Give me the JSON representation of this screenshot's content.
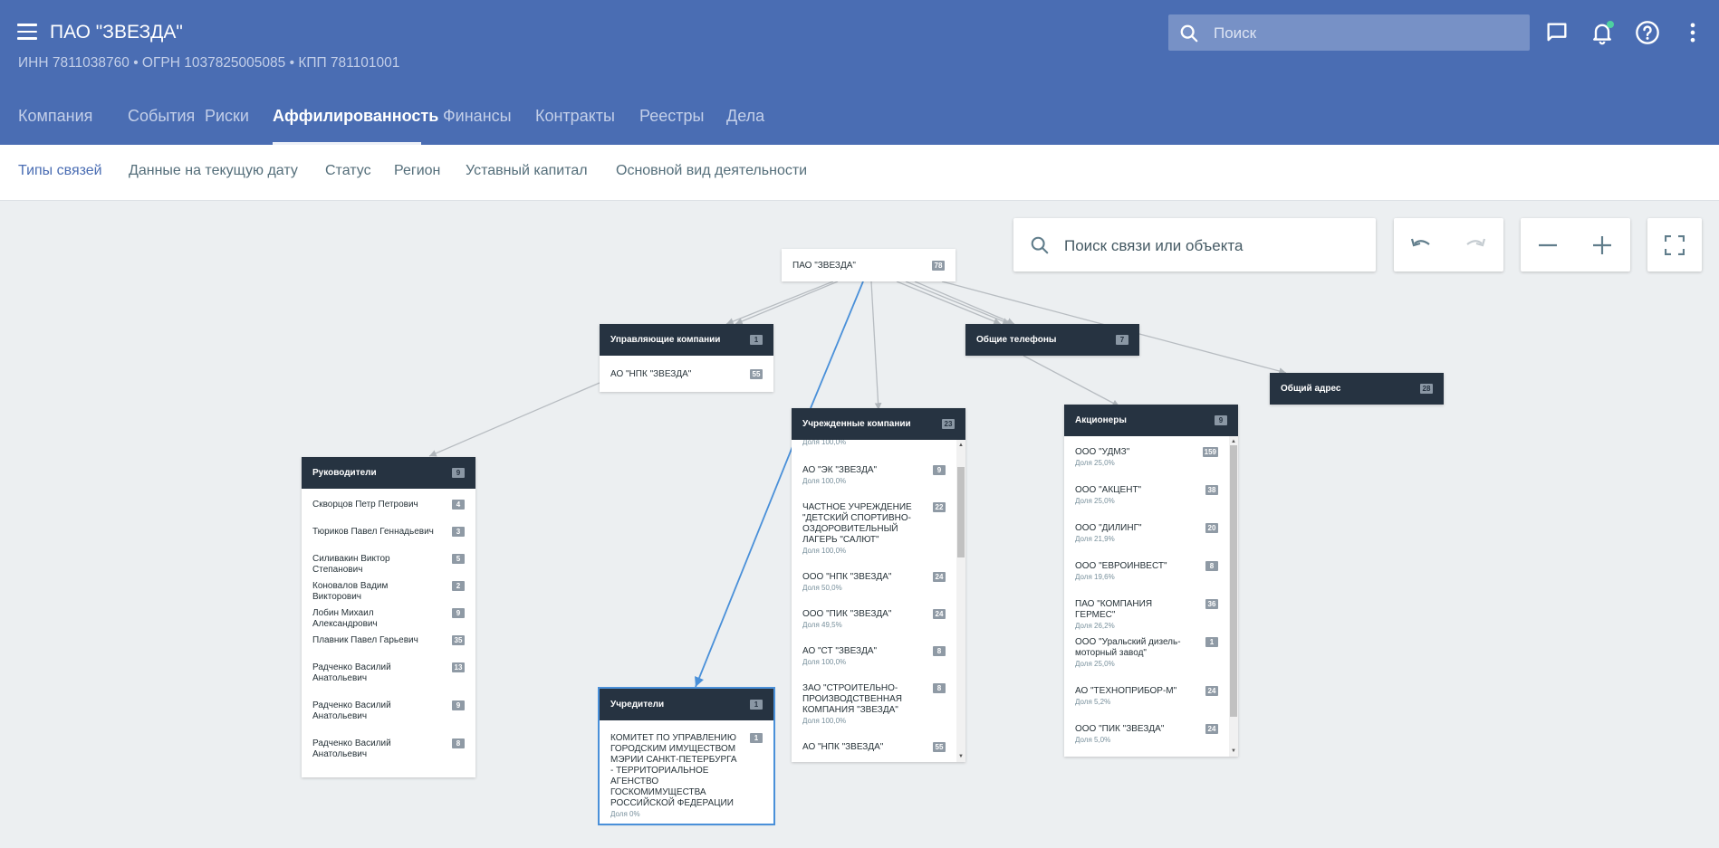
{
  "header": {
    "title": "ПАО \"ЗВЕЗДА\"",
    "ids": "ИНН 7811038760  •  ОГРН 1037825005085  •  КПП 781101001",
    "search_placeholder": "Поиск",
    "tabs": [
      {
        "label": "Компания"
      },
      {
        "label": "События"
      },
      {
        "label": "Риски"
      },
      {
        "label": "Аффилированность"
      },
      {
        "label": "Финансы"
      },
      {
        "label": "Контракты"
      },
      {
        "label": "Реестры"
      },
      {
        "label": "Дела"
      }
    ],
    "active_tab": "Аффилированность",
    "colors": {
      "brand": "#4a6db3",
      "node_header": "#263341",
      "edge_highlight": "#4a90d9",
      "notification": "#4dd0a0"
    }
  },
  "subnav": {
    "items": [
      {
        "label": "Типы связей"
      },
      {
        "label": "Данные на текущую дату"
      },
      {
        "label": "Статус"
      },
      {
        "label": "Регион"
      },
      {
        "label": "Уставный капитал"
      },
      {
        "label": "Основной вид деятельности"
      }
    ],
    "active": "Типы связей"
  },
  "graph": {
    "search_placeholder": "Поиск связи или объекта",
    "icons": [
      "undo-icon",
      "redo-icon",
      "zoom-out-icon",
      "zoom-in-icon",
      "fullscreen-icon"
    ],
    "root": {
      "label": "ПАО \"ЗВЕЗДА\"",
      "count": "78"
    },
    "managing": {
      "title": "Управляющие компании",
      "count": "1",
      "items": [
        {
          "name": "АО \"НПК \"ЗВЕЗДА\"",
          "count": "55"
        }
      ]
    },
    "phones": {
      "title": "Общие телефоны",
      "count": "7"
    },
    "address": {
      "title": "Общий адрес",
      "count": "28"
    },
    "leaders": {
      "title": "Руководители",
      "count": "9",
      "items": [
        {
          "name": "Скворцов Петр Петрович",
          "count": "4"
        },
        {
          "name": "Тюриков Павел Геннадьевич",
          "count": "3"
        },
        {
          "name": "Силивакин Виктор Степанович",
          "count": "5"
        },
        {
          "name": "Коновалов Вадим Викторович",
          "count": "2"
        },
        {
          "name": "Лобин Михаил Александрович",
          "count": "9"
        },
        {
          "name": "Плавник Павел Гарьевич",
          "count": "35"
        },
        {
          "name": "Радченко Василий Анатольевич",
          "count": "13"
        },
        {
          "name": "Радченко Василий Анатольевич",
          "count": "9"
        },
        {
          "name": "Радченко Василий Анатольевич",
          "count": "8"
        }
      ]
    },
    "founded": {
      "title": "Учрежденные компании",
      "count": "23",
      "top_cut": "Доля 100,0%",
      "items": [
        {
          "name": "АО \"ЭК \"ЗВЕЗДА\"",
          "share": "Доля 100,0%",
          "count": "9"
        },
        {
          "name": "ЧАСТНОЕ УЧРЕЖДЕНИЕ \"ДЕТСКИЙ СПОРТИВНО-ОЗДОРОВИТЕЛЬНЫЙ ЛАГЕРЬ \"САЛЮТ\"",
          "share": "Доля 100,0%",
          "count": "22"
        },
        {
          "name": "ООО \"НПК \"ЗВЕЗДА\"",
          "share": "Доля 50,0%",
          "count": "24"
        },
        {
          "name": "ООО \"ПИК \"ЗВЕЗДА\"",
          "share": "Доля 49,5%",
          "count": "24"
        },
        {
          "name": "АО \"СТ \"ЗВЕЗДА\"",
          "share": "Доля 100,0%",
          "count": "8"
        },
        {
          "name": "ЗАО \"СТРОИТЕЛЬНО-ПРОИЗВОДСТВЕННАЯ КОМПАНИЯ \"ЗВЕЗДА\"",
          "share": "Доля 100,0%",
          "count": "8"
        },
        {
          "name": "АО \"НПК \"ЗВЕЗДА\"",
          "share": "",
          "count": "55"
        }
      ]
    },
    "shareholders": {
      "title": "Акционеры",
      "count": "9",
      "items": [
        {
          "name": "ООО \"УДМЗ\"",
          "share": "Доля 25,0%",
          "count": "159"
        },
        {
          "name": "ООО \"АКЦЕНТ\"",
          "share": "Доля 25,0%",
          "count": "38"
        },
        {
          "name": "ООО \"ДИЛИНГ\"",
          "share": "Доля 21,9%",
          "count": "20"
        },
        {
          "name": "ООО \"ЕВРОИНВЕСТ\"",
          "share": "Доля 19,6%",
          "count": "8"
        },
        {
          "name": "ПАО \"КОМПАНИЯ ГЕРМЕС\"",
          "share": "Доля 26,2%",
          "count": "36"
        },
        {
          "name": "ООО \"Уральский дизель-моторный завод\"",
          "share": "Доля 25,0%",
          "count": "1"
        },
        {
          "name": "АО \"ТЕХНОПРИБОР-М\"",
          "share": "Доля 5,2%",
          "count": "24"
        },
        {
          "name": "ООО \"ПИК \"ЗВЕЗДА\"",
          "share": "Доля 5,0%",
          "count": "24"
        }
      ]
    },
    "founders": {
      "title": "Учредители",
      "count": "1",
      "items": [
        {
          "name": "КОМИТЕТ ПО УПРАВЛЕНИЮ ГОРОДСКИМ ИМУЩЕСТВОМ МЭРИИ САНКТ-ПЕТЕРБУРГА - ТЕРРИТОРИАЛЬНОЕ АГЕНСТВО ГОСКОМИМУЩЕСТВА РОССИЙСКОЙ ФЕДЕРАЦИИ",
          "share": "Доля 0%",
          "count": "1"
        }
      ]
    }
  }
}
